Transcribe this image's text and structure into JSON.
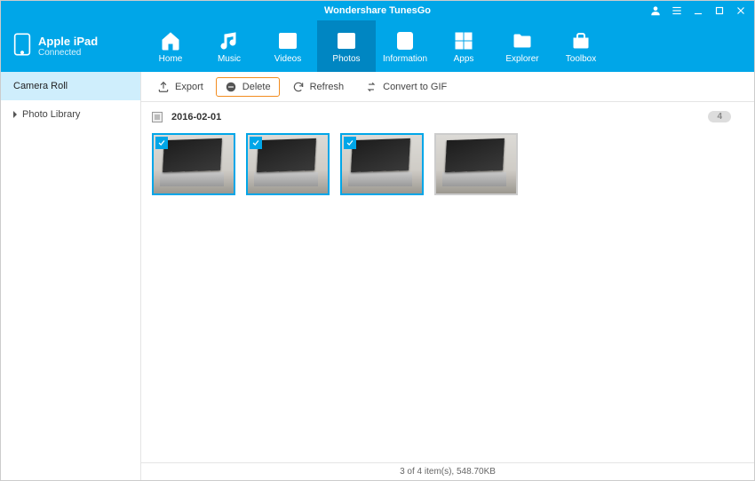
{
  "app": {
    "title": "Wondershare TunesGo"
  },
  "device": {
    "name": "Apple iPad",
    "status": "Connected"
  },
  "nav": [
    {
      "label": "Home"
    },
    {
      "label": "Music"
    },
    {
      "label": "Videos"
    },
    {
      "label": "Photos"
    },
    {
      "label": "Information"
    },
    {
      "label": "Apps"
    },
    {
      "label": "Explorer"
    },
    {
      "label": "Toolbox"
    }
  ],
  "sidebar": {
    "items": [
      {
        "label": "Camera Roll"
      },
      {
        "label": "Photo Library"
      }
    ]
  },
  "toolbar": {
    "export_label": "Export",
    "delete_label": "Delete",
    "refresh_label": "Refresh",
    "gif_label": "Convert to GIF"
  },
  "group": {
    "date": "2016-02-01",
    "badge": "4"
  },
  "status": {
    "text": "3 of 4 item(s), 548.70KB"
  }
}
